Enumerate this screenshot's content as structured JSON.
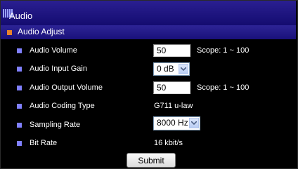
{
  "window": {
    "title": "Audio"
  },
  "section": {
    "title": "Audio Adjust"
  },
  "rows": {
    "audio_volume": {
      "label": "Audio Volume",
      "value": "50",
      "scope": "Scope: 1 ~ 100"
    },
    "input_gain": {
      "label": "Audio Input Gain",
      "selected": "0 dB"
    },
    "output_volume": {
      "label": "Audio Output Volume",
      "value": "50",
      "scope": "Scope: 1 ~ 100"
    },
    "coding_type": {
      "label": "Audio Coding Type",
      "value": "G711 u-law"
    },
    "sampling_rate": {
      "label": "Sampling Rate",
      "selected": "8000 Hz"
    },
    "bit_rate": {
      "label": "Bit Rate",
      "value": "16 kbit/s"
    }
  },
  "actions": {
    "submit_label": "Submit"
  },
  "colors": {
    "title_bar": "#1e148a",
    "section_bullet": "#e8832a",
    "row_bullet": "#8080ff",
    "background": "#000000"
  }
}
